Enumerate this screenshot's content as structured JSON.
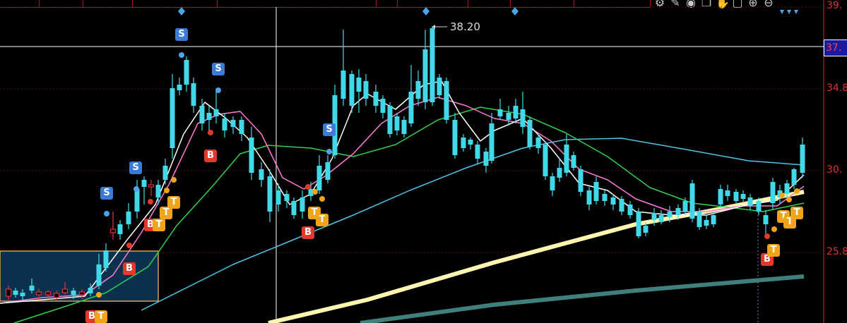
{
  "toolbar": {
    "segments": 10
  },
  "right_toolbar": {
    "icons": [
      "gear-icon",
      "brush-icon",
      "eye-icon",
      "copy-icon",
      "hand-icon",
      "lock-icon",
      "zoom-in-icon",
      "zoom-out-icon"
    ]
  },
  "price_axis": {
    "labels": [
      "39.",
      "34.8",
      "30.",
      "25.8"
    ],
    "current_price_tag": "37."
  },
  "chart": {
    "high_label": "38.20",
    "colors": {
      "up": "#e0333a",
      "down": "#41d9e8",
      "ma_white": "#ffffff",
      "ma_pink": "#ff7ad8",
      "ma_green": "#2fd24a",
      "ma_cyan": "#4fc3e8",
      "ma_yellow": "#fff7b0",
      "ma_teal": "#3f7f7c"
    },
    "signals": [
      {
        "type": "S",
        "label": "S"
      },
      {
        "type": "S",
        "label": "S"
      },
      {
        "type": "S",
        "label": "S"
      },
      {
        "type": "S",
        "label": "S"
      },
      {
        "type": "S",
        "label": "S"
      },
      {
        "type": "B",
        "label": "B"
      },
      {
        "type": "B",
        "label": "B"
      },
      {
        "type": "B",
        "label": "B"
      },
      {
        "type": "B",
        "label": "B"
      },
      {
        "type": "B",
        "label": "B"
      },
      {
        "type": "B",
        "label": "B"
      },
      {
        "type": "T",
        "label": "T"
      },
      {
        "type": "T",
        "label": "T"
      },
      {
        "type": "T",
        "label": "T"
      },
      {
        "type": "T",
        "label": "T"
      },
      {
        "type": "T",
        "label": "T"
      },
      {
        "type": "T",
        "label": "T"
      },
      {
        "type": "T",
        "label": "T"
      },
      {
        "type": "T",
        "label": "T"
      },
      {
        "type": "T",
        "label": "T"
      },
      {
        "type": "T",
        "label": "T"
      },
      {
        "type": "T",
        "label": "T"
      }
    ]
  }
}
